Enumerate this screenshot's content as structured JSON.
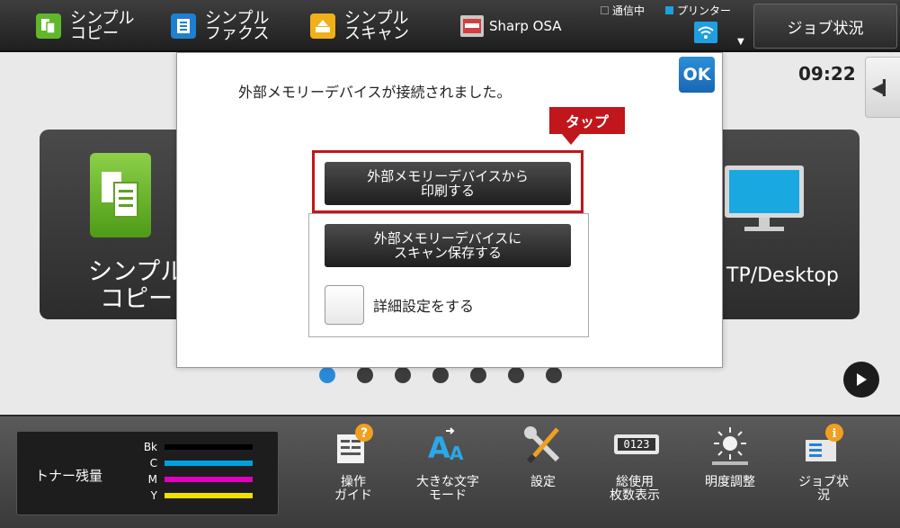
{
  "topbar": {
    "apps": [
      {
        "line1": "シンプル",
        "line2": "コピー"
      },
      {
        "line1": "シンプル",
        "line2": "ファクス"
      },
      {
        "line1": "シンプル",
        "line2": "スキャン"
      }
    ],
    "sharp_label": "Sharp OSA",
    "status_comm": "通信中",
    "status_printer": "プリンター",
    "job_status_label": "ジョブ状況"
  },
  "main": {
    "clock": "09:22",
    "tile_copy": {
      "line1": "シンプル",
      "line2": "コピー"
    },
    "tile_desktop_label": "TP/Desktop",
    "page_dots": 7,
    "active_dot": 0
  },
  "dialog": {
    "message": "外部メモリーデバイスが接続されました。",
    "ok_label": "OK",
    "callout": "タップ",
    "print_btn": {
      "line1": "外部メモリーデバイスから",
      "line2": "印刷する"
    },
    "scan_btn": {
      "line1": "外部メモリーデバイスに",
      "line2": "スキャン保存する"
    },
    "detail_label": "詳細設定をする"
  },
  "bottombar": {
    "toner_title": "トナー残量",
    "toner": [
      {
        "letter": "Bk",
        "color": "#000000"
      },
      {
        "letter": "C",
        "color": "#00a0e0"
      },
      {
        "letter": "M",
        "color": "#e000c0"
      },
      {
        "letter": "Y",
        "color": "#f0e000"
      }
    ],
    "tools": [
      {
        "line1": "操作",
        "line2": "ガイド"
      },
      {
        "line1": "大きな文字",
        "line2": "モード"
      },
      {
        "line1": "設定",
        "line2": ""
      },
      {
        "line1": "総使用",
        "line2": "枚数表示"
      },
      {
        "line1": "明度調整",
        "line2": ""
      },
      {
        "line1": "ジョブ状",
        "line2": "況"
      }
    ],
    "counter_digits": "0123"
  }
}
